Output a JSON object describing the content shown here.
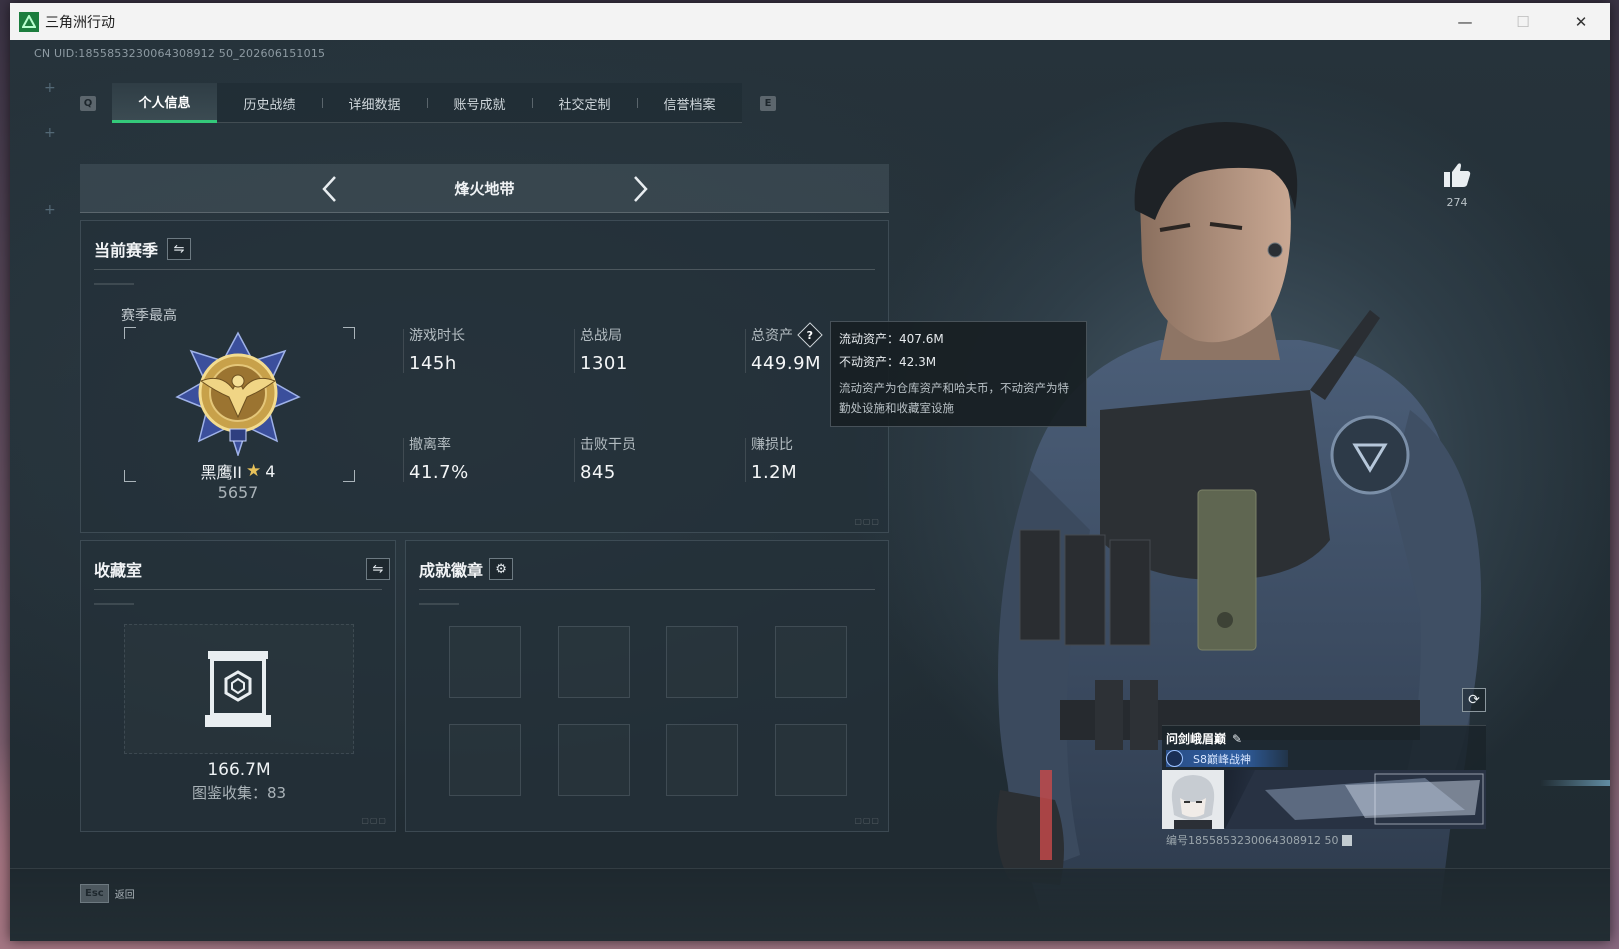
{
  "window": {
    "title": "三角洲行动",
    "controls": {
      "minimize": "—",
      "maximize": "☐",
      "close": "✕"
    }
  },
  "uid_text": "CN UID:1855853230064308912 50_202606151015",
  "tabs": {
    "prev_key": "Q",
    "next_key": "E",
    "items": [
      {
        "label": "个人信息",
        "active": true
      },
      {
        "label": "历史战绩",
        "active": false
      },
      {
        "label": "详细数据",
        "active": false
      },
      {
        "label": "账号成就",
        "active": false
      },
      {
        "label": "社交定制",
        "active": false
      },
      {
        "label": "信誉档案",
        "active": false
      }
    ]
  },
  "mode": {
    "title": "烽火地带"
  },
  "season": {
    "title": "当前赛季",
    "best_label": "赛季最高",
    "rank_name": "黑鹰II",
    "rank_stars": "4",
    "rank_score": "5657",
    "stats": {
      "play_time": {
        "label": "游戏时长",
        "value": "145h"
      },
      "total_matches": {
        "label": "总战局",
        "value": "1301"
      },
      "total_assets": {
        "label": "总资产",
        "value": "449.9M"
      },
      "extract_rate": {
        "label": "撤离率",
        "value": "41.7%"
      },
      "kills": {
        "label": "击败干员",
        "value": "845"
      },
      "profit_ratio": {
        "label": "赚损比",
        "value": "1.2M"
      }
    }
  },
  "tooltip": {
    "liquid": "流动资产：407.6M",
    "fixed": "不动资产：42.3M",
    "desc": "流动资产为仓库资产和哈夫币，不动资产为特勤处设施和收藏室设施"
  },
  "collection": {
    "title": "收藏室",
    "value": "166.7M",
    "count": "图鉴收集：83"
  },
  "achievements": {
    "title": "成就徽章"
  },
  "likes": {
    "count": "274"
  },
  "card": {
    "name": "问剑峨眉巅",
    "title": "S8巅峰战神",
    "id_text": "编号1855853230064308912 50"
  },
  "footer": {
    "esc_key": "Esc",
    "esc_label": "返回"
  },
  "colors": {
    "accent": "#34c97a",
    "panel_bg": "#243139",
    "title_blue": "#2f5fa2"
  }
}
